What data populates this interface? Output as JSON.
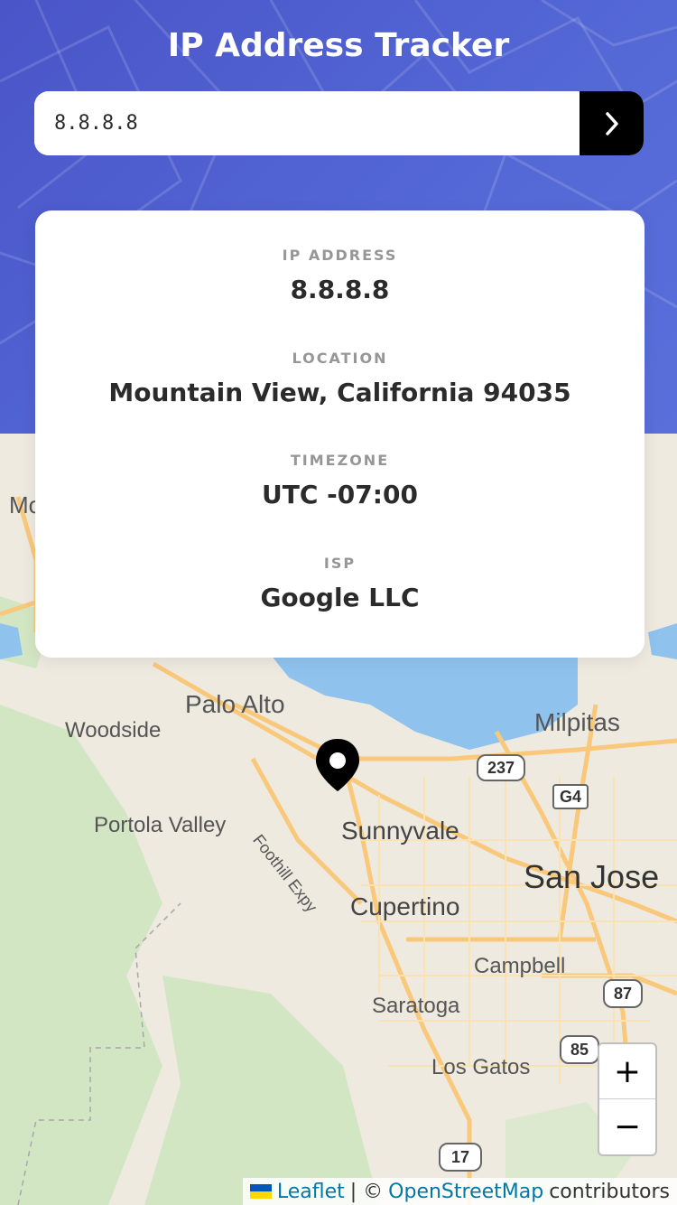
{
  "app": {
    "title": "IP Address Tracker"
  },
  "search": {
    "value": "8.8.8.8"
  },
  "info": {
    "ip": {
      "label": "IP ADDRESS",
      "value": "8.8.8.8"
    },
    "location": {
      "label": "LOCATION",
      "value": "Mountain View, California 94035"
    },
    "timezone": {
      "label": "TIMEZONE",
      "value": "UTC -07:00"
    },
    "isp": {
      "label": "ISP",
      "value": "Google LLC"
    }
  },
  "map": {
    "cities": {
      "mountain": "Mo",
      "palo_alto": "Palo Alto",
      "woodside": "Woodside",
      "portola_valley": "Portola Valley",
      "sunnyvale": "Sunnyvale",
      "milpitas": "Milpitas",
      "san_jose": "San Jose",
      "cupertino": "Cupertino",
      "campbell": "Campbell",
      "saratoga": "Saratoga",
      "los_gatos": "Los Gatos",
      "foothill_expy": "Foothill Expy"
    },
    "shields": {
      "r237": "237",
      "g4": "G4",
      "r87": "87",
      "r85": "85",
      "r17": "17"
    },
    "zoom_in_label": "+",
    "zoom_out_label": "−"
  },
  "attribution": {
    "leaflet": "Leaflet",
    "separator": "| ©",
    "osm": "OpenStreetMap",
    "contributors": "contributors"
  },
  "colors": {
    "header_accent": "#5468d6",
    "button": "#000000",
    "map_water": "#8fc3ee",
    "map_road": "#f9c87a",
    "map_land": "#eeeae0",
    "map_green": "#d3e6c4"
  }
}
